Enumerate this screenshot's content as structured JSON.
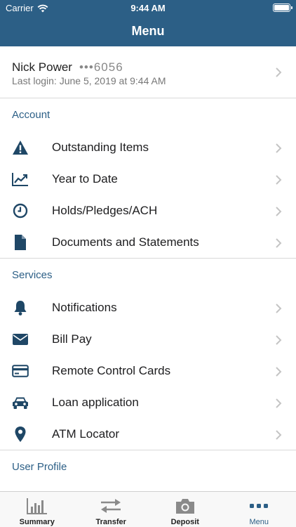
{
  "status_bar": {
    "carrier": "Carrier",
    "time": "9:44 AM"
  },
  "nav": {
    "title": "Menu"
  },
  "account": {
    "name": "Nick Power",
    "masked_number": "•••6056",
    "last_login": "Last login: June 5, 2019 at 9:44 AM"
  },
  "sections": {
    "account": {
      "title": "Account",
      "items": [
        {
          "label": "Outstanding Items",
          "icon": "warning-icon"
        },
        {
          "label": "Year to Date",
          "icon": "trend-chart-icon"
        },
        {
          "label": "Holds/Pledges/ACH",
          "icon": "clock-icon"
        },
        {
          "label": "Documents and Statements",
          "icon": "document-icon"
        }
      ]
    },
    "services": {
      "title": "Services",
      "items": [
        {
          "label": "Notifications",
          "icon": "bell-icon"
        },
        {
          "label": "Bill Pay",
          "icon": "envelope-icon"
        },
        {
          "label": "Remote Control Cards",
          "icon": "credit-card-icon"
        },
        {
          "label": "Loan application",
          "icon": "car-icon"
        },
        {
          "label": "ATM Locator",
          "icon": "map-pin-icon"
        }
      ]
    },
    "user_profile": {
      "title": "User Profile"
    }
  },
  "tabs": [
    {
      "label": "Summary",
      "icon": "bar-chart-icon",
      "active": false
    },
    {
      "label": "Transfer",
      "icon": "transfer-arrows-icon",
      "active": false
    },
    {
      "label": "Deposit",
      "icon": "camera-icon",
      "active": false
    },
    {
      "label": "Menu",
      "icon": "more-dots-icon",
      "active": true
    }
  ],
  "colors": {
    "brand": "#2c5f86",
    "icon": "#1f4766",
    "chevron": "#c4c4c4",
    "divider": "#d9d9d9"
  }
}
